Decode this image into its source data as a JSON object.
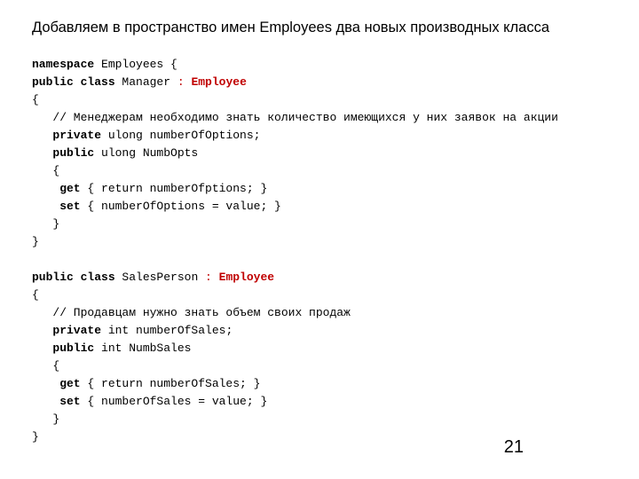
{
  "title": "Добавляем в пространство имен Employees два новых производных класса",
  "code": {
    "l1_kw": "namespace",
    "l1_rest": " Employees {",
    "l2_kw": "public class",
    "l2_name": " Manager ",
    "l2_colon": ":",
    "l2_base": " Employee",
    "l3": "{",
    "l4": "   // Менеджерам необходимо знать количество имеющихся у них заявок на акции",
    "l5_kw": "   private",
    "l5_rest": " ulong numberOfOptions;",
    "l6_kw": "   public",
    "l6_rest": " ulong NumbOpts",
    "l7": "   {",
    "l8_kw": "    get",
    "l8_rest": " { return numberOfptions; }",
    "l9_kw": "    set",
    "l9_rest": " { numberOfOptions = value; }",
    "l10": "   }",
    "l11": "}",
    "blank1": "",
    "l12_kw": "public class",
    "l12_name": " SalesPerson ",
    "l12_colon": ":",
    "l12_base": " Employee",
    "l13": "{",
    "l14": "   // Продавцам нужно знать объем своих продаж",
    "l15_kw": "   private",
    "l15_rest": " int numberOfSales;",
    "l16_kw": "   public",
    "l16_rest": " int NumbSales",
    "l17": "   {",
    "l18_kw": "    get",
    "l18_rest": " { return numberOfSales; }",
    "l19_kw": "    set",
    "l19_rest": " { numberOfSales = value; }",
    "l20": "   }",
    "l21": "}"
  },
  "pagenum": "21"
}
